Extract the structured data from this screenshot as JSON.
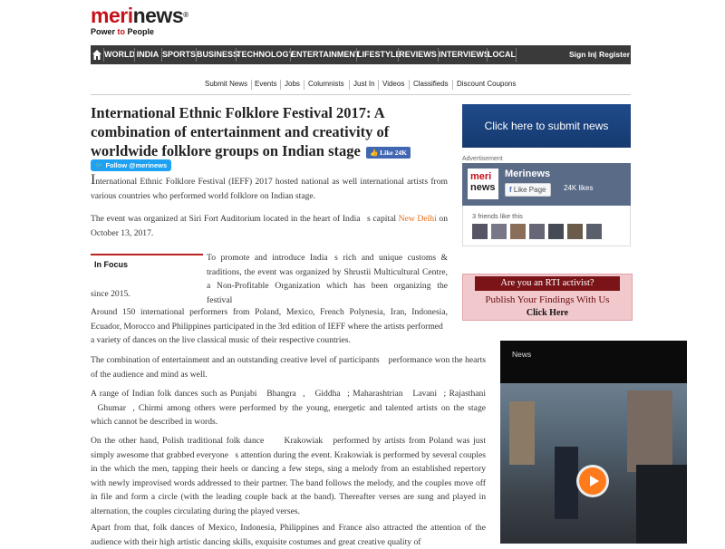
{
  "logo": {
    "brand_red": "mer",
    "brand_red2": "i",
    "brand_dark": "news",
    "reg": "®",
    "tagline_a": "Power ",
    "tagline_b": "to",
    "tagline_c": " People"
  },
  "nav": {
    "items": [
      "WORLD",
      "INDIA",
      "SPORTS",
      "BUSINESS",
      "TECHNOLOGY",
      "ENTERTAINMENT",
      "LIFESTYLE",
      "REVIEWS",
      "INTERVIEWS",
      "LOCAL"
    ],
    "sign_in": "Sign In",
    "divider": "|",
    "register": "Register",
    "home_icon": "home-icon"
  },
  "subnav": [
    "Submit News",
    "Events",
    "Jobs",
    "Columnists",
    "Just In",
    "Videos",
    "Classifieds",
    "Discount Coupons"
  ],
  "article": {
    "title": "International Ethnic Folklore Festival 2017: A combination of entertainment and creativity of worldwide folklore groups on Indian stage",
    "like_label": "Like 24K",
    "follow_label": "Follow @merinews",
    "p1_first": "I",
    "p1_rest": "nternational Ethnic Folklore Festival (IEFF) 2017 hosted national as well international artists from various countries who performed world folklore on Indian stage.",
    "p2_a": "The event was organized at Siri Fort Auditorium located in the heart of India\u0000s capital ",
    "p2_link": "New Delhi",
    "p2_b": " on October 13, 2017.",
    "in_focus": "In Focus",
    "p3a": "To promote and introduce India\u0000s rich and unique customs & traditions, the event was organized by Shrustii Multicultural Centre, a Non-Profitable Organization which has been organizing the festival",
    "p3b": "since 2015.",
    "p4a": "Around 150 international performers from Poland, Mexico, French Polynesia, Iran, Indonesia, Ecuador, Morocco and Philippines participated in the 3rd edition of IEFF where the artists performed",
    "p4b": "a variety of dances on the live classical music of their respective countries.",
    "p5": "The combination of entertainment and an outstanding creative level of participants\u0000 performance won the hearts of the audience and mind as well.",
    "p6": "A range of Indian folk dances such as Punjabi \u0000Bhangra\u0000, \u0000Giddha\u0000; Maharashtrian \u0000Lavani\u0000; Rajasthani \u0000Ghumar\u0000, Chirmi among others were performed by the young, energetic and talented artists on the stage which cannot be described in words.",
    "p7": "On the other hand, Polish traditional folk dance \u0000 \u0000Krakowiak\u0000 performed by artists from Poland was just simply awesome that grabbed everyone\u0000s attention during the event. Krakowiak is performed by several couples in the which the men, tapping their heels or dancing a few steps, sing a melody from an established repertory with newly improvised words addressed to their partner. The band follows the melody, and the couples move off in file and form a circle (with the leading couple back at the band). Thereafter verses are sung and played in alternation, the couples circulating during the played verses.",
    "p8": "Apart from that, folk dances of Mexico, Indonesia, Philippines and France also attracted the attention of the audience with their high artistic dancing skills, exquisite costumes and great creative quality of"
  },
  "sidebar": {
    "submit_banner": "Click here to submit news",
    "advertisement": "Advertisement",
    "fb_page_name": "Merinews",
    "fb_logo_1": "meri",
    "fb_logo_2": "news",
    "fb_like_page": "Like Page",
    "fb_likes": "24K likes",
    "fb_friends": "3 friends like this",
    "rti_title": "Are you an RTI activist?",
    "rti_line2": "Publish Your Findings With Us",
    "rti_line3": "Click Here",
    "video_label": "News"
  }
}
